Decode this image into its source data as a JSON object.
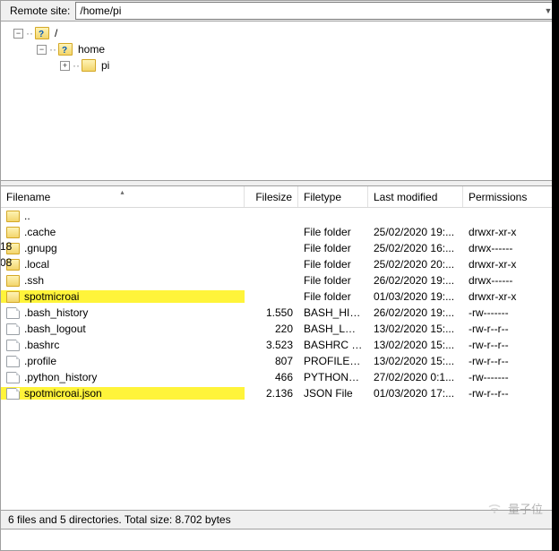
{
  "address_bar": {
    "label": "Remote site:",
    "value": "/home/pi"
  },
  "tree": {
    "root": {
      "expander": "−",
      "label": "/"
    },
    "home": {
      "expander": "−",
      "label": "home"
    },
    "pi": {
      "expander": "+",
      "label": "pi"
    }
  },
  "edge_hints": {
    "a": "18",
    "b": "08"
  },
  "columns": {
    "filename": "Filename",
    "filesize": "Filesize",
    "filetype": "Filetype",
    "modified": "Last modified",
    "perms": "Permissions"
  },
  "rows": [
    {
      "kind": "up",
      "name": "..",
      "size": "",
      "type": "",
      "mod": "",
      "perm": ""
    },
    {
      "kind": "folder",
      "name": ".cache",
      "size": "",
      "type": "File folder",
      "mod": "25/02/2020 19:...",
      "perm": "drwxr-xr-x"
    },
    {
      "kind": "folder",
      "name": ".gnupg",
      "size": "",
      "type": "File folder",
      "mod": "25/02/2020 16:...",
      "perm": "drwx------"
    },
    {
      "kind": "folder",
      "name": ".local",
      "size": "",
      "type": "File folder",
      "mod": "25/02/2020 20:...",
      "perm": "drwxr-xr-x"
    },
    {
      "kind": "folder",
      "name": ".ssh",
      "size": "",
      "type": "File folder",
      "mod": "26/02/2020 19:...",
      "perm": "drwx------"
    },
    {
      "kind": "folder",
      "name": "spotmicroai",
      "size": "",
      "type": "File folder",
      "mod": "01/03/2020 19:...",
      "perm": "drwxr-xr-x",
      "hl": true
    },
    {
      "kind": "file",
      "name": ".bash_history",
      "size": "1.550",
      "type": "BASH_HIST...",
      "mod": "26/02/2020 19:...",
      "perm": "-rw-------"
    },
    {
      "kind": "file",
      "name": ".bash_logout",
      "size": "220",
      "type": "BASH_LOG...",
      "mod": "13/02/2020 15:...",
      "perm": "-rw-r--r--"
    },
    {
      "kind": "file",
      "name": ".bashrc",
      "size": "3.523",
      "type": "BASHRC File",
      "mod": "13/02/2020 15:...",
      "perm": "-rw-r--r--"
    },
    {
      "kind": "file",
      "name": ".profile",
      "size": "807",
      "type": "PROFILE File",
      "mod": "13/02/2020 15:...",
      "perm": "-rw-r--r--"
    },
    {
      "kind": "file",
      "name": ".python_history",
      "size": "466",
      "type": "PYTHON_...",
      "mod": "27/02/2020 0:1...",
      "perm": "-rw-------"
    },
    {
      "kind": "file",
      "name": "spotmicroai.json",
      "size": "2.136",
      "type": "JSON File",
      "mod": "01/03/2020 17:...",
      "perm": "-rw-r--r--",
      "hl": true
    }
  ],
  "status": "6 files and 5 directories. Total size: 8.702 bytes",
  "watermark": "量子位"
}
